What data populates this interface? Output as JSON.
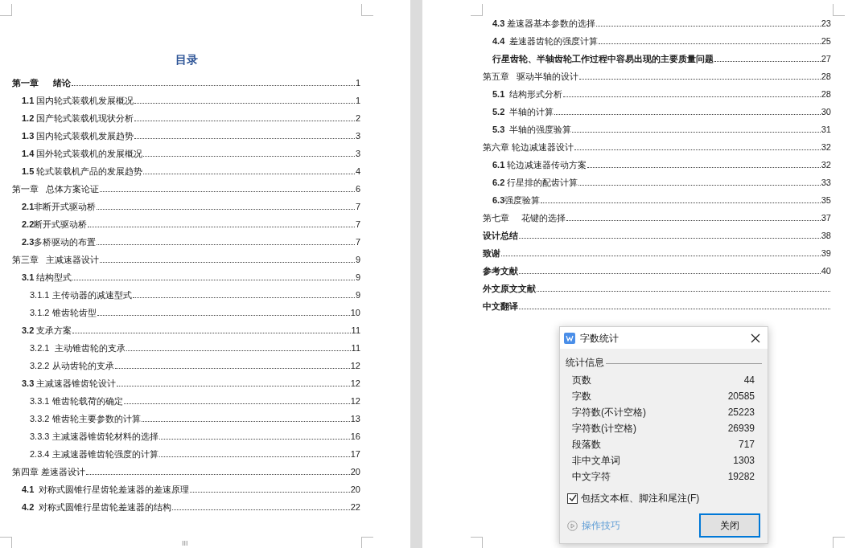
{
  "pages": [
    {
      "heading": "目录",
      "footer": "III",
      "entries": [
        {
          "text": "第一章      绪论",
          "bold": true,
          "page": "1",
          "children": [
            {
              "text": "**1.1** 国内轮式装载机发展概况",
              "page": "1"
            },
            {
              "text": "**1.2** 国产轮式装载机现状分析",
              "page": "2"
            },
            {
              "text": "**1.3** 国内轮式装载机发展趋势",
              "page": "3"
            },
            {
              "text": "**1.4** 国外轮式装载机的发展概况",
              "page": "3"
            },
            {
              "text": "**1.5** 轮式装载机产品的发展趋势",
              "page": "4"
            }
          ]
        },
        {
          "text": "第一章   总体方案论证",
          "bold": false,
          "page": "6",
          "children": [
            {
              "text": "**2.1**非断开式驱动桥",
              "page": "7"
            },
            {
              "text": "**2.2**断开式驱动桥",
              "page": "7"
            },
            {
              "text": "**2.3**多桥驱动的布置",
              "page": "7"
            }
          ]
        },
        {
          "text": "第三章   主减速器设计",
          "bold": false,
          "page": "9",
          "children": [
            {
              "text": "**3.1** 结构型式",
              "page": "9",
              "children": [
                {
                  "text": "3.1.1 主传动器的减速型式",
                  "page": "9"
                },
                {
                  "text": "3.1.2 锥齿轮齿型",
                  "page": "10"
                }
              ]
            },
            {
              "text": "**3.2** 支承方案",
              "page": "11",
              "children": [
                {
                  "text": "3.2.1  主动锥齿轮的支承",
                  "page": "11"
                },
                {
                  "text": "3.2.2 从动齿轮的支承",
                  "page": "12"
                }
              ]
            },
            {
              "text": "**3.3** 主减速器锥齿轮设计",
              "page": "12",
              "children": [
                {
                  "text": "3.3.1 锥齿轮载荷的确定",
                  "page": "12"
                },
                {
                  "text": "3.3.2 锥齿轮主要参数的计算",
                  "page": "13"
                },
                {
                  "text": "3.3.3 主减速器锥齿轮材料的选择",
                  "page": "16"
                },
                {
                  "text": "2.3.4 主减速器锥齿轮强度的计算",
                  "page": "17"
                }
              ]
            }
          ]
        },
        {
          "text": "第四章 差速器设计",
          "bold": false,
          "page": "20",
          "children": [
            {
              "text": "**4.1**  对称式圆锥行星齿轮差速器的差速原理",
              "page": "20"
            },
            {
              "text": "**4.2**  对称式圆锥行星齿轮差速器的结构",
              "page": "22"
            }
          ]
        }
      ]
    },
    {
      "continued_sections": [
        {
          "text": "**4.3** 差速器基本参数的选择",
          "page": "23"
        },
        {
          "text": "**4.4**  差速器齿轮的强度计算",
          "page": "25"
        },
        {
          "text": "**行星齿轮、半轴齿轮工作过程中容易出现的主要质量问题**",
          "page": "27"
        }
      ],
      "entries": [
        {
          "text": "第五章   驱动半轴的设计",
          "bold": false,
          "page": "28",
          "children": [
            {
              "text": "**5.1**  结构形式分析",
              "page": "28"
            },
            {
              "text": "**5.2**  半轴的计算",
              "page": "30"
            },
            {
              "text": "**5.3**  半轴的强度验算",
              "page": "31"
            }
          ]
        },
        {
          "text": "第六章 轮边减速器设计",
          "bold": false,
          "page": "32",
          "children": [
            {
              "text": "**6.1** 轮边减速器传动方案",
              "page": "32"
            },
            {
              "text": "**6.2** 行星排的配齿计算",
              "page": "33"
            },
            {
              "text": "**6.3**强度验算",
              "page": "35"
            }
          ]
        },
        {
          "text": "第七章     花键的选择",
          "bold": false,
          "page": "37"
        },
        {
          "text": "设计总结",
          "bold": true,
          "page": "38"
        },
        {
          "text": "致谢",
          "bold": true,
          "page": "39"
        },
        {
          "text": "参考文献",
          "bold": true,
          "page": "40"
        },
        {
          "text": "外文原文文献",
          "bold": true
        },
        {
          "text": "中文翻译",
          "bold": true
        }
      ]
    }
  ],
  "dialog": {
    "title": "字数统计",
    "group": "统计信息",
    "stats": [
      {
        "label": "页数",
        "value": "44"
      },
      {
        "label": "字数",
        "value": "20585"
      },
      {
        "label": "字符数(不计空格)",
        "value": "25223"
      },
      {
        "label": "字符数(计空格)",
        "value": "26939"
      },
      {
        "label": "段落数",
        "value": "717"
      },
      {
        "label": "非中文单词",
        "value": "1303"
      },
      {
        "label": "中文字符",
        "value": "19282"
      }
    ],
    "option": {
      "label": "包括文本框、脚注和尾注(F)",
      "checked": true
    },
    "tips_link": "操作技巧",
    "button": "关闭"
  }
}
